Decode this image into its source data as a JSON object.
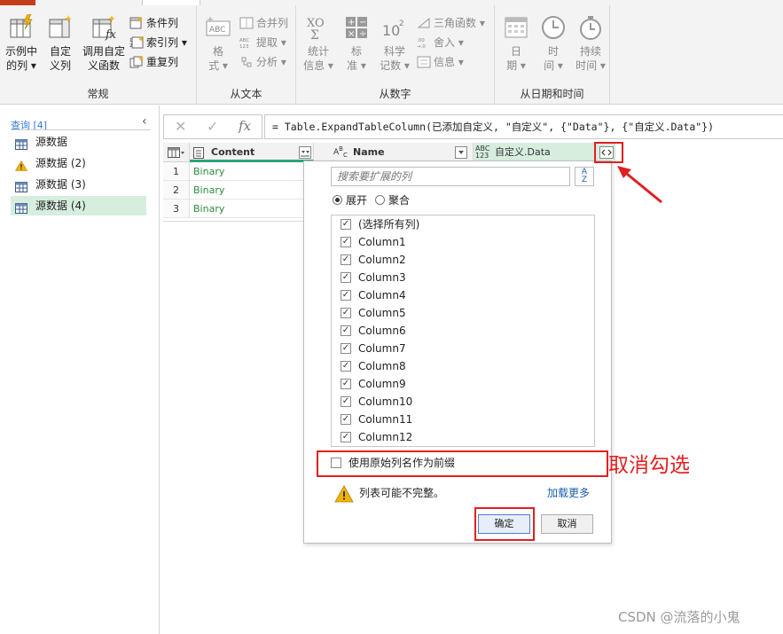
{
  "ribbon": {
    "accent": "#c43e1c",
    "groups": [
      {
        "label": "常规",
        "big_buttons": [
          {
            "label": "示例中\n的列 ▾",
            "icon": "column-from-examples-icon"
          },
          {
            "label": "自定\n义列",
            "icon": "custom-column-icon"
          },
          {
            "label": "调用自定\n义函数",
            "icon": "invoke-function-icon"
          }
        ],
        "small_buttons": [
          {
            "label": "条件列",
            "icon": "conditional-column-icon"
          },
          {
            "label": "索引列 ▾",
            "icon": "index-column-icon"
          },
          {
            "label": "重复列",
            "icon": "duplicate-column-icon"
          }
        ]
      },
      {
        "label": "从文本",
        "big_buttons": [
          {
            "label": "格\n式 ▾",
            "icon": "format-icon"
          }
        ],
        "small_buttons": [
          {
            "label": "合并列",
            "icon": "merge-columns-icon"
          },
          {
            "label": "提取 ▾",
            "icon": "extract-icon"
          },
          {
            "label": "分析 ▾",
            "icon": "parse-icon"
          }
        ]
      },
      {
        "label": "从数字",
        "big_buttons": [
          {
            "label": "统计\n信息 ▾",
            "icon": "statistics-icon"
          },
          {
            "label": "标\n准 ▾",
            "icon": "standard-icon"
          },
          {
            "label": "科学\n记数 ▾",
            "icon": "scientific-icon"
          }
        ],
        "small_buttons": [
          {
            "label": "三角函数 ▾",
            "icon": "trigonometry-icon"
          },
          {
            "label": "舍入 ▾",
            "icon": "rounding-icon"
          },
          {
            "label": "信息 ▾",
            "icon": "information-icon"
          }
        ]
      },
      {
        "label": "从日期和时间",
        "big_buttons": [
          {
            "label": "日\n期 ▾",
            "icon": "date-icon"
          },
          {
            "label": "时\n间 ▾",
            "icon": "time-icon"
          },
          {
            "label": "持续\n时间 ▾",
            "icon": "duration-icon"
          }
        ],
        "small_buttons": []
      }
    ]
  },
  "queries": {
    "header": "查询 [4]",
    "items": [
      {
        "label": "源数据",
        "icon": "table-icon",
        "selected": false
      },
      {
        "label": "源数据 (2)",
        "icon": "warning-icon",
        "selected": false
      },
      {
        "label": "源数据 (3)",
        "icon": "table-icon",
        "selected": false
      },
      {
        "label": "源数据 (4)",
        "icon": "table-icon",
        "selected": true
      }
    ]
  },
  "formula_bar": {
    "formula": "= Table.ExpandTableColumn(已添加自定义, \"自定义\", {\"Data\"}, {\"自定义.Data\"})"
  },
  "grid": {
    "columns": [
      {
        "label": "Content",
        "type_icon": "binary-type-icon"
      },
      {
        "label": "Name",
        "type_icon": "text-type-icon"
      },
      {
        "label": "自定义.Data",
        "type_icon": "any-type-icon",
        "type_text": "ABC\n123"
      }
    ],
    "rows": [
      {
        "num": "1",
        "content": "Binary"
      },
      {
        "num": "2",
        "content": "Binary"
      },
      {
        "num": "3",
        "content": "Binary"
      }
    ],
    "cell_color": "#2d8a3e",
    "selected_color": "#d7eedf"
  },
  "expand_dropdown": {
    "search_placeholder": "搜索要扩展的列",
    "sort_label": "A\nZ",
    "radio_expand": "展开",
    "radio_aggregate": "聚合",
    "columns": [
      {
        "label": "(选择所有列)",
        "checked": true
      },
      {
        "label": "Column1",
        "checked": true
      },
      {
        "label": "Column2",
        "checked": true
      },
      {
        "label": "Column3",
        "checked": true
      },
      {
        "label": "Column4",
        "checked": true
      },
      {
        "label": "Column5",
        "checked": true
      },
      {
        "label": "Column6",
        "checked": true
      },
      {
        "label": "Column7",
        "checked": true
      },
      {
        "label": "Column8",
        "checked": true
      },
      {
        "label": "Column9",
        "checked": true
      },
      {
        "label": "Column10",
        "checked": true
      },
      {
        "label": "Column11",
        "checked": true
      },
      {
        "label": "Column12",
        "checked": true
      }
    ],
    "prefix_label": "使用原始列名作为前缀",
    "prefix_checked": false,
    "warning": "列表可能不完整。",
    "load_more": "加载更多",
    "ok": "确定",
    "cancel": "取消"
  },
  "annotation": {
    "text": "取消勾选",
    "color": "#e02020"
  },
  "watermark": "CSDN @流落的小鬼"
}
